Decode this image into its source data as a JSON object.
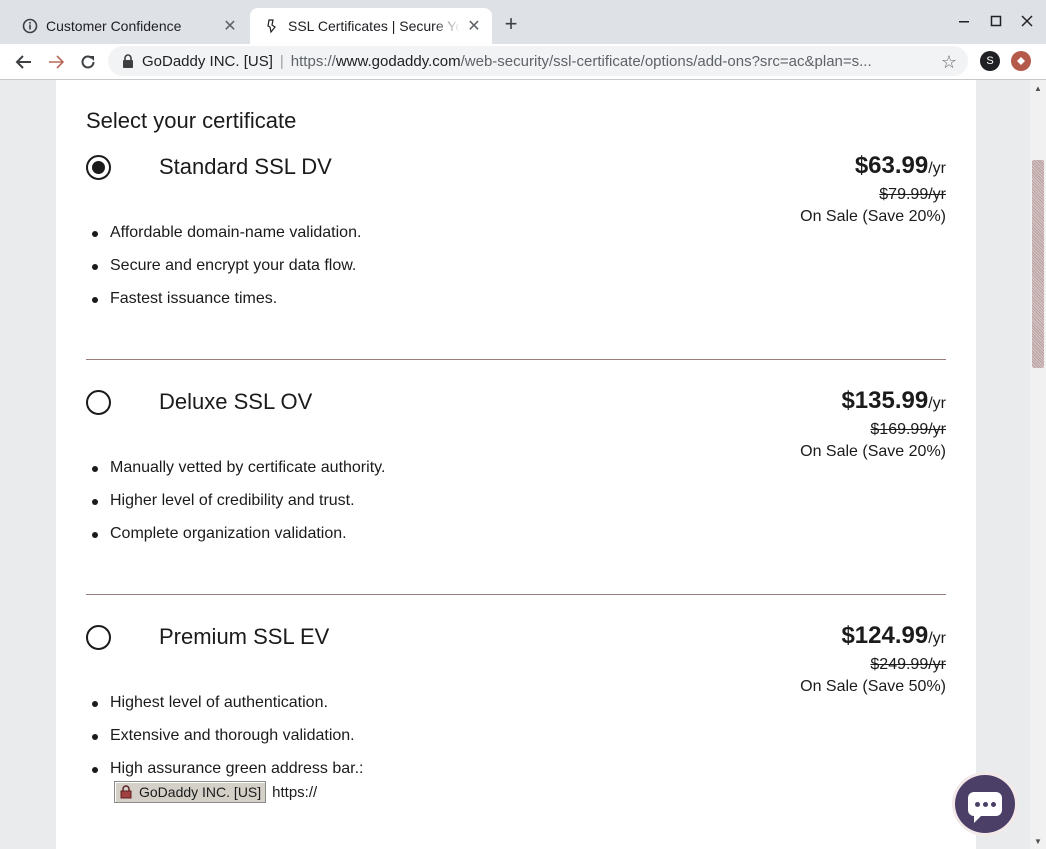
{
  "browser": {
    "tabs": [
      {
        "title": "Customer Confidence",
        "active": false,
        "icon": "info-icon"
      },
      {
        "title": "SSL Certificates | Secure Your Website",
        "active": true,
        "icon": "godaddy-icon"
      }
    ],
    "address_bar": {
      "org": "GoDaddy INC. [US]",
      "separator": "|",
      "url_prefix": "https://",
      "url_domain": "www.godaddy.com",
      "url_path": "/web-security/ssl-certificate/options/add-ons?src=ac&plan=s..."
    },
    "extension_letter": "S"
  },
  "page": {
    "section_title": "Select your certificate",
    "plans": [
      {
        "name": "Standard SSL DV",
        "selected": true,
        "price": "$63.99",
        "per": "/yr",
        "old_price": "$79.99/yr",
        "sale": "On Sale (Save 20%)",
        "features": [
          "Affordable domain-name validation.",
          "Secure and encrypt your data flow.",
          "Fastest issuance times."
        ]
      },
      {
        "name": "Deluxe SSL OV",
        "selected": false,
        "price": "$135.99",
        "per": "/yr",
        "old_price": "$169.99/yr",
        "sale": "On Sale (Save 20%)",
        "features": [
          "Manually vetted by certificate authority.",
          "Higher level of credibility and trust.",
          "Complete organization validation."
        ]
      },
      {
        "name": "Premium SSL EV",
        "selected": false,
        "price": "$124.99",
        "per": "/yr",
        "old_price": "$249.99/yr",
        "sale": "On Sale (Save 50%)",
        "features": [
          "Highest level of authentication.",
          "Extensive and thorough validation.",
          "High assurance green address bar.:"
        ]
      }
    ],
    "address_demo": {
      "chip_label": "GoDaddy INC. [US]",
      "url_text": "https://"
    }
  },
  "colors": {
    "divider": "#9a7d7d",
    "chat_bubble": "#4b3f67"
  }
}
